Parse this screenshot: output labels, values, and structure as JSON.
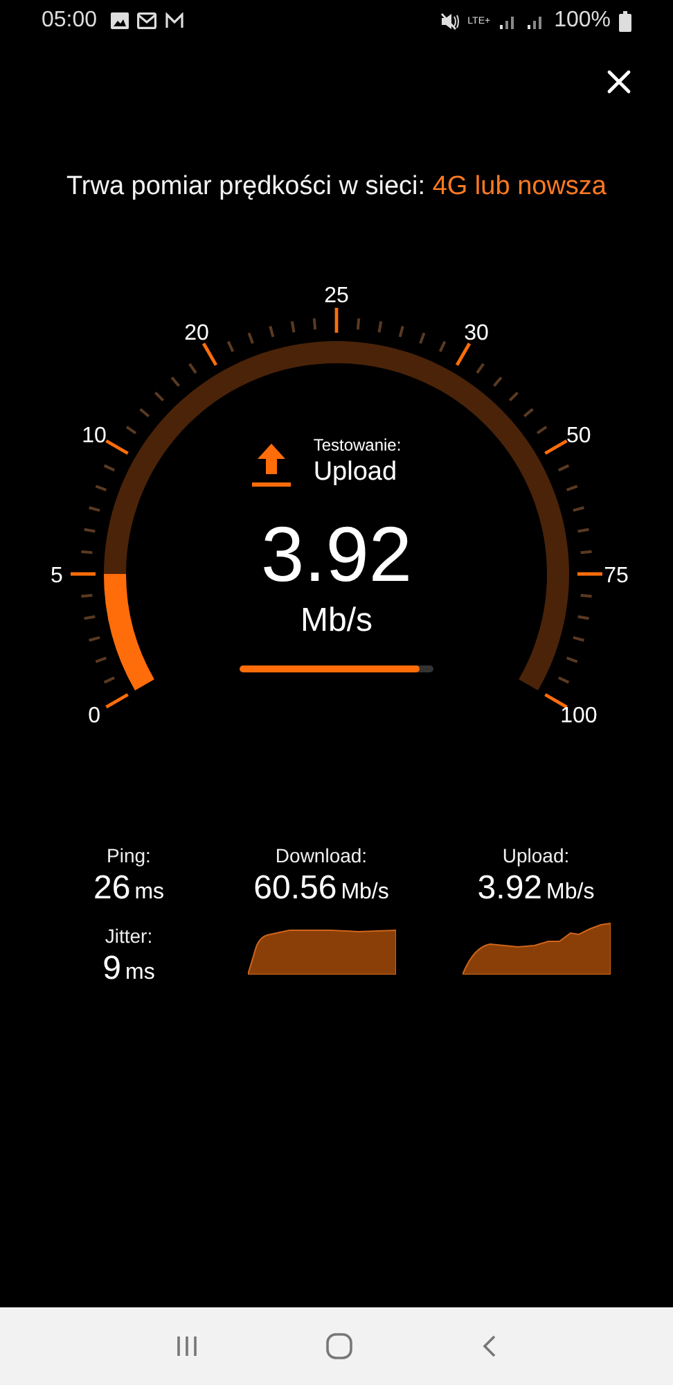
{
  "status_bar": {
    "time": "05:00",
    "network": "LTE+",
    "battery": "100%"
  },
  "heading": {
    "text": "Trwa pomiar prędkości w sieci:",
    "network": "4G lub nowsza"
  },
  "gauge": {
    "scale": [
      {
        "label": "0"
      },
      {
        "label": "5"
      },
      {
        "label": "10"
      },
      {
        "label": "20"
      },
      {
        "label": "25"
      },
      {
        "label": "30"
      },
      {
        "label": "50"
      },
      {
        "label": "75"
      },
      {
        "label": "100"
      }
    ],
    "test_label": "Testowanie:",
    "test_name": "Upload",
    "value": "3.92",
    "unit": "Mb/s",
    "progress": {
      "level": 0.93
    }
  },
  "results": {
    "ping": {
      "label": "Ping:",
      "value": "26",
      "unit": "ms"
    },
    "jitter": {
      "label": "Jitter:",
      "value": "9",
      "unit": "ms"
    },
    "download": {
      "label": "Download:",
      "value": "60.56",
      "unit": "Mb/s"
    },
    "upload": {
      "label": "Upload:",
      "value": "3.92",
      "unit": "Mb/s"
    }
  }
}
